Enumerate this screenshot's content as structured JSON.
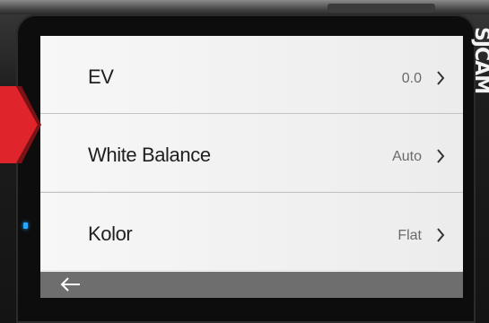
{
  "device": {
    "brand": "SJCAM",
    "led_color": "#2aa8ff",
    "accent_color": "#e05555"
  },
  "menu": {
    "items": [
      {
        "label": "EV",
        "value": "0.0",
        "icon": "chevron-right-icon"
      },
      {
        "label": "White Balance",
        "value": "Auto",
        "icon": "chevron-right-icon"
      },
      {
        "label": "Kolor",
        "value": "Flat",
        "icon": "chevron-right-icon"
      }
    ]
  },
  "bottom_bar": {
    "back_icon": "back-arrow-icon",
    "color": "#6e6e6e"
  },
  "highlight": {
    "icon": "pointer-arrow-icon",
    "color": "#e0242c"
  }
}
